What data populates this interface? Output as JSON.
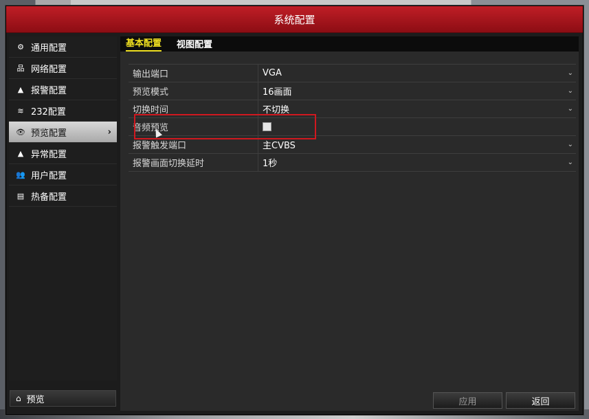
{
  "window": {
    "title": "系统配置"
  },
  "sidebar": {
    "items": [
      {
        "label": "通用配置",
        "icon": "gear-icon",
        "glyph": "⚙"
      },
      {
        "label": "网络配置",
        "icon": "network-icon",
        "glyph": "品"
      },
      {
        "label": "报警配置",
        "icon": "alarm-icon",
        "glyph": "▲"
      },
      {
        "label": "232配置",
        "icon": "serial-port-icon",
        "glyph": "≋"
      },
      {
        "label": "预览配置",
        "icon": "eye-icon",
        "glyph": "👁",
        "active": true
      },
      {
        "label": "异常配置",
        "icon": "warning-icon",
        "glyph": "▲"
      },
      {
        "label": "用户配置",
        "icon": "users-icon",
        "glyph": "👥"
      },
      {
        "label": "热备配置",
        "icon": "hot-spare-icon",
        "glyph": "▤"
      }
    ],
    "footer": {
      "label": "预览",
      "icon": "home-icon",
      "glyph": "⌂"
    }
  },
  "tabs": [
    {
      "label": "基本配置",
      "active": true
    },
    {
      "label": "视图配置",
      "active": false
    }
  ],
  "form": {
    "rows": [
      {
        "label": "输出端口",
        "value": "VGA",
        "type": "dropdown"
      },
      {
        "label": "预览模式",
        "value": "16画面",
        "type": "dropdown"
      },
      {
        "label": "切换时间",
        "value": "不切换",
        "type": "dropdown"
      },
      {
        "label": "音频预览",
        "value": "",
        "type": "checkbox",
        "checked": false
      },
      {
        "label": "报警触发端口",
        "value": "主CVBS",
        "type": "dropdown"
      },
      {
        "label": "报警画面切换延时",
        "value": "1秒",
        "type": "dropdown"
      }
    ]
  },
  "buttons": {
    "apply": "应用",
    "back": "返回"
  },
  "colors": {
    "title_bar": "#b01820",
    "active_tab": "#f0e020",
    "highlight_box": "#d1181f"
  }
}
